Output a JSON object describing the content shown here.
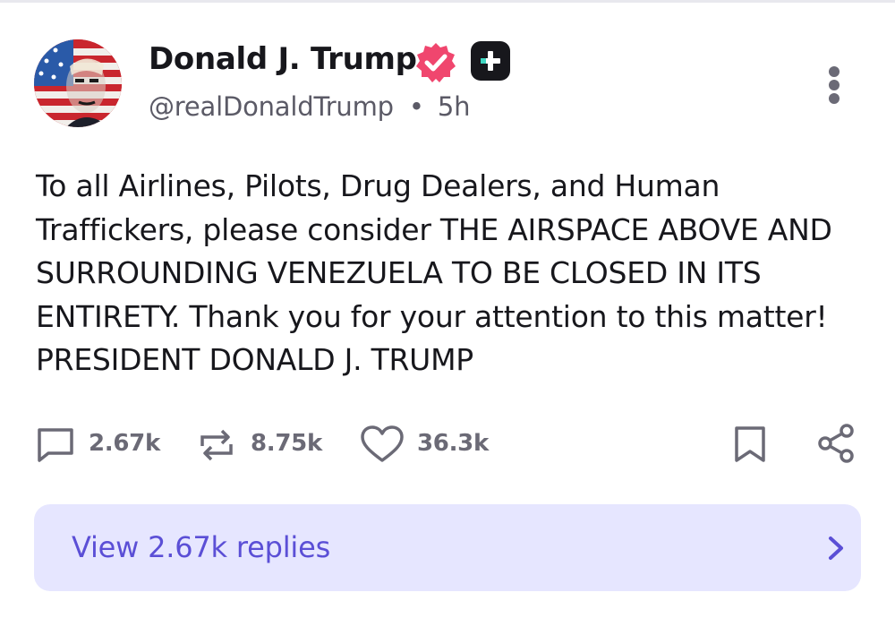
{
  "post": {
    "author_name": "Donald J. Trump",
    "handle": "@realDonaldTrump",
    "separator": "•",
    "time": "5h",
    "text": "To all Airlines, Pilots, Drug Dealers, and Human Traffickers, please consider THE AIRSPACE ABOVE AND SURROUNDING VENEZUELA TO BE CLOSED IN ITS ENTIRETY. Thank you for your attention to this matter! PRESIDENT DONALD J. TRUMP"
  },
  "badges": {
    "verified_icon": "verified-badge-icon",
    "plus_icon": "plus-badge-icon",
    "verified_color": "#f0466e"
  },
  "actions": {
    "replies_count": "2.67k",
    "reposts_count": "8.75k",
    "likes_count": "36.3k",
    "bookmark_icon": "bookmark-icon",
    "share_icon": "share-icon"
  },
  "replies_button": {
    "label": "View 2.67k replies"
  },
  "colors": {
    "accent": "#5b4fd6",
    "replies_bg": "#e6e6ff",
    "muted": "#6b6a76",
    "text": "#17171c"
  }
}
